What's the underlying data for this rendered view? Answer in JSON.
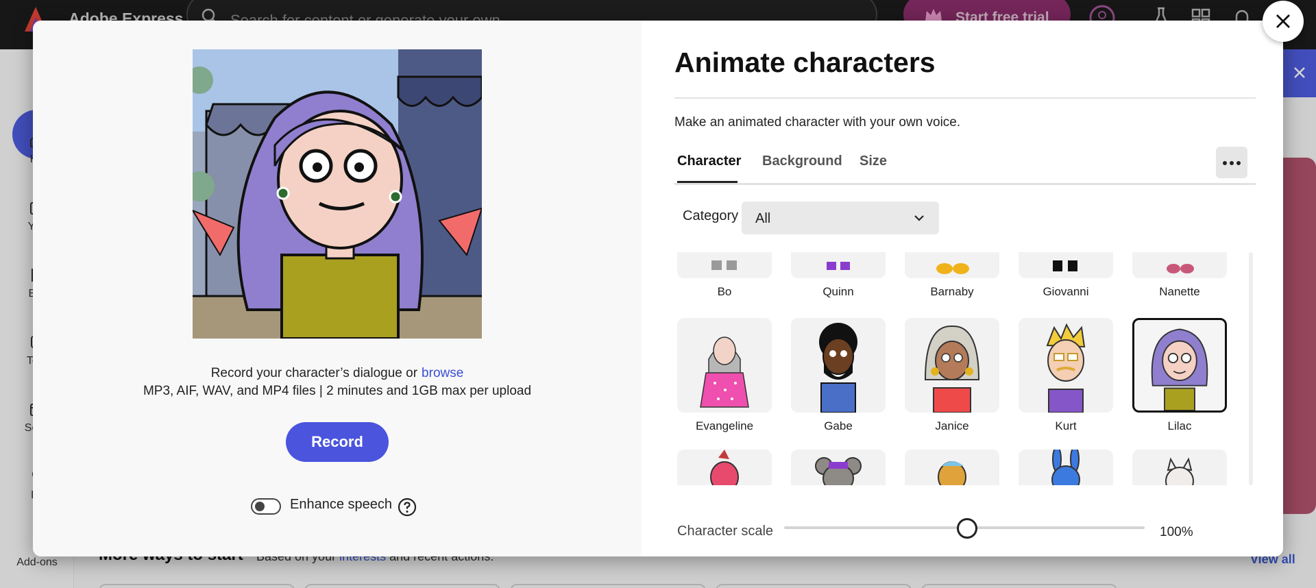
{
  "app": {
    "brand": "Adobe Express",
    "search_placeholder": "Search for content or generate your own",
    "trial_button": "Start free trial"
  },
  "sidebar": {
    "items": [
      {
        "label": "Ho"
      },
      {
        "label": "You"
      },
      {
        "label": "Bra"
      },
      {
        "label": "Tem"
      },
      {
        "label": "Sche"
      },
      {
        "label": "Le"
      },
      {
        "label": "Add-ons"
      }
    ]
  },
  "background": {
    "heading": "More ways to start",
    "sub_before": "Based on your",
    "sub_link": "interests",
    "sub_after": "and recent actions.",
    "view_all": "View all"
  },
  "modal": {
    "title": "Animate characters",
    "subtitle": "Make an animated character with your own voice.",
    "tabs": [
      {
        "label": "Character",
        "active": true
      },
      {
        "label": "Background",
        "active": false
      },
      {
        "label": "Size",
        "active": false
      }
    ],
    "category": {
      "label": "Category",
      "value": "All"
    },
    "record": {
      "prompt": "Record your character’s dialogue or",
      "browse": "browse",
      "formats": "MP3, AIF, WAV, and MP4 files | 2 minutes and 1GB max per upload",
      "button": "Record"
    },
    "enhance_speech": {
      "label": "Enhance speech",
      "enabled": false
    },
    "characters_row1": [
      "Bo",
      "Quinn",
      "Barnaby",
      "Giovanni",
      "Nanette"
    ],
    "characters_row2": [
      "Evangeline",
      "Gabe",
      "Janice",
      "Kurt",
      "Lilac"
    ],
    "selected_character": "Lilac",
    "scale": {
      "label": "Character scale",
      "value_text": "100%",
      "value": 1.0
    }
  },
  "colors": {
    "accent": "#4a54dd",
    "topbar": "#1c1c1c",
    "trial": "#8a2d6a"
  }
}
